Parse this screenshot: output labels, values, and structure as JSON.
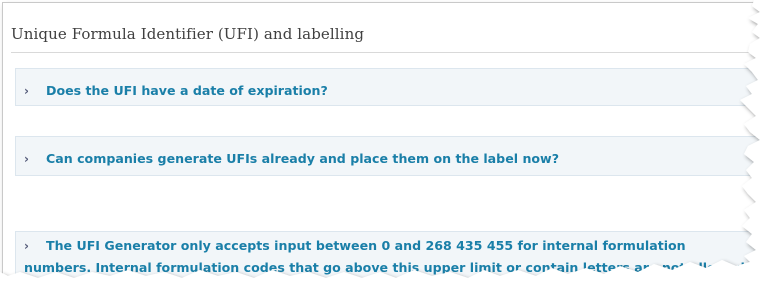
{
  "section": {
    "title": "Unique Formula Identifier (UFI) and labelling"
  },
  "faq": {
    "items": [
      {
        "chevron": "›",
        "question": "Does the UFI have a date of expiration?"
      },
      {
        "chevron": "›",
        "question": "Can companies generate UFIs already and place them on the label now?"
      },
      {
        "chevron": "›",
        "question": "The UFI Generator only accepts input between 0 and 268 435 455 for internal formulation numbers. Internal formulation codes that go above this upper limit or contain letters are not allowed. Can the UFI Generator be changed?"
      }
    ]
  },
  "colors": {
    "question_text": "#1a7fa8",
    "chevron": "#555b7a",
    "item_background": "#f2f6f9",
    "item_border": "#dce6ee",
    "title_text": "#404040"
  }
}
